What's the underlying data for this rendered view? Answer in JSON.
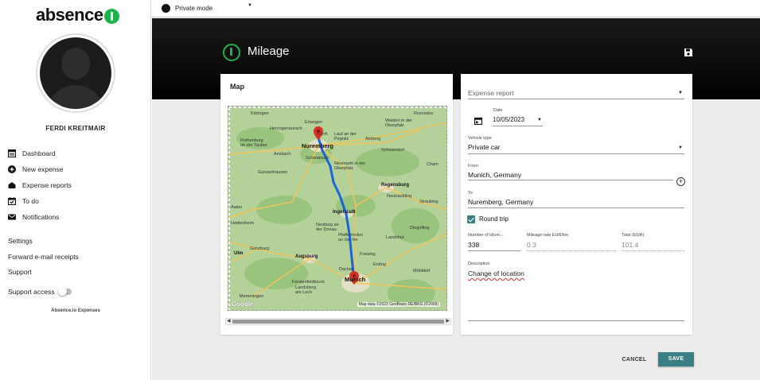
{
  "brand": {
    "name": "absence",
    "accent": "#1db34a"
  },
  "topbar": {
    "mode_label": "Private mode"
  },
  "user": {
    "name": "FERDI KREITMAIR"
  },
  "sidebar": {
    "items": [
      {
        "label": "Dashboard",
        "icon": "dashboard-icon"
      },
      {
        "label": "New expense",
        "icon": "plus-circle-icon"
      },
      {
        "label": "Expense reports",
        "icon": "wallet-icon"
      },
      {
        "label": "To do",
        "icon": "checkbox-calendar-icon"
      },
      {
        "label": "Notifications",
        "icon": "mail-icon"
      }
    ],
    "links": [
      "Settings",
      "Forward e-mail receipts",
      "Support"
    ],
    "support_access_label": "Support access",
    "support_access_enabled": false,
    "footer": "Absence.io Expenses"
  },
  "page": {
    "title": "Mileage",
    "save_icon": "floppy-disk-icon"
  },
  "map": {
    "title": "Map",
    "attribution": "Map data ©2023 GeoBasis-DE/BKG (©2009)",
    "google": "Google",
    "cities": {
      "kitzingen": "Kitzingen",
      "erlangen": "Erlangen",
      "rozvadov": "Rozvadov",
      "herzogenaurach": "Herzogenaurach",
      "fuerth": "Fürth",
      "lauf": "Lauf an der Pegnitz",
      "weiden": "Weiden in der Oberpfalz",
      "rothenburg": "Rothenburg ob der Tauber",
      "nuremberg": "Nuremberg",
      "amberg": "Amberg",
      "schwandorf": "Schwandorf",
      "ansbach": "Ansbach",
      "schwabach": "Schwabach",
      "cham": "Cham",
      "neumarkt": "Neumarkt in der Oberpfalz",
      "gunzenhausen": "Gunzenhausen",
      "regensburg": "Regensburg",
      "neutraubling": "Neutraubling",
      "straubing": "Straubing",
      "aalen": "Aalen",
      "ingolstadt": "Ingolstadt",
      "heidenheim": "Heidenheim",
      "neuburg": "Neuburg an der Donau",
      "dingolfing": "Dingolfing",
      "pfaffenhofen": "Pfaffenhofen an der Ilm",
      "landshut": "Landshut",
      "ulm": "Ulm",
      "gunzburg": "Günzburg",
      "augsburg": "Augsburg",
      "freising": "Freising",
      "erding": "Erding",
      "dachau": "Dachau",
      "muhldorf": "Mühldorf",
      "munich": "Munich",
      "furstenfeldbruck": "Fürstenfeldbruck",
      "landsberg": "Landsberg am Lech",
      "memmingen": "Memmingen"
    }
  },
  "form": {
    "expense_report_placeholder": "Expense report",
    "date_label": "Date",
    "date_value": "10/05/2023",
    "vehicle_label": "Vehicle type",
    "vehicle_value": "Private car",
    "from_label": "From",
    "from_value": "Munich, Germany",
    "to_label": "To",
    "to_value": "Nuremberg, Germany",
    "round_trip_label": "Round trip",
    "round_trip_checked": true,
    "km_label": "Number of kilom...",
    "km_value": "338",
    "rate_label": "Mileage rate EUR/km",
    "rate_value": "0.3",
    "total_label": "Total (EUR)",
    "total_value": "101.4",
    "description_label": "Description",
    "description_value": "Change of location"
  },
  "actions": {
    "cancel": "CANCEL",
    "save": "SAVE",
    "save_color": "#3a7f83"
  }
}
